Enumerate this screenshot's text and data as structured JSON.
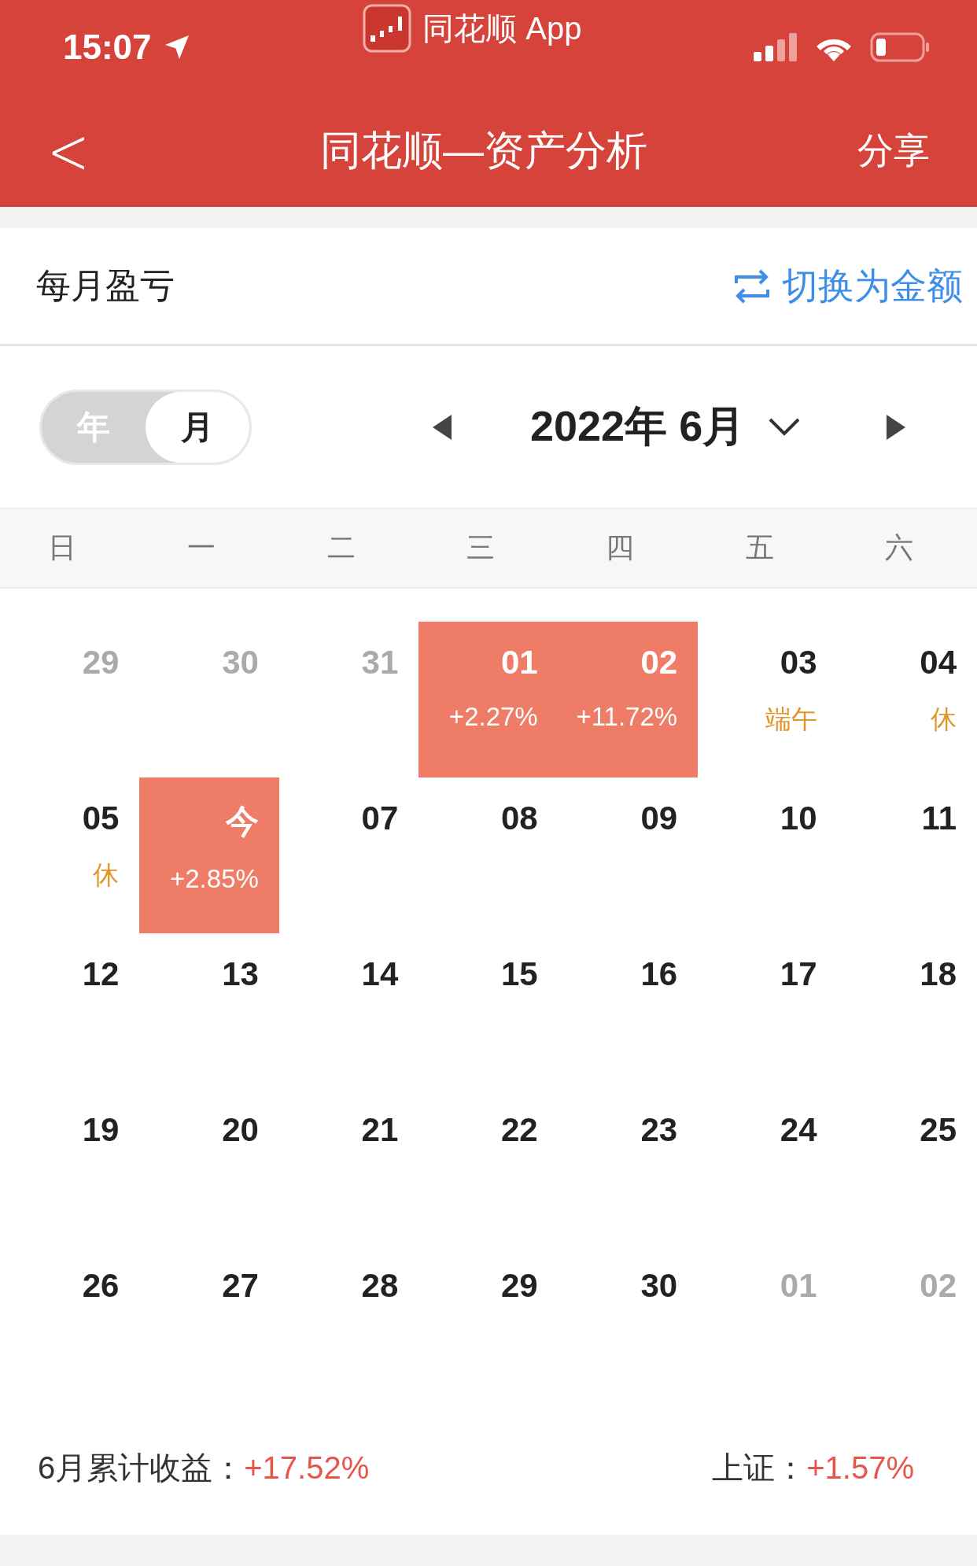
{
  "status_bar": {
    "time": "15:07",
    "app_badge": "同花顺 App"
  },
  "nav": {
    "back": "<",
    "title": "同花顺—资产分析",
    "share": "分享"
  },
  "section": {
    "title": "每月盈亏",
    "switch_link": "切换为金额"
  },
  "mode_tabs": [
    {
      "label": "年",
      "selected": false
    },
    {
      "label": "月",
      "selected": true
    }
  ],
  "month_picker": {
    "label": "2022年 6月"
  },
  "weekdays": [
    "日",
    "一",
    "二",
    "三",
    "四",
    "五",
    "六"
  ],
  "days": [
    {
      "day": "29",
      "kind": "other"
    },
    {
      "day": "30",
      "kind": "other"
    },
    {
      "day": "31",
      "kind": "other"
    },
    {
      "day": "01",
      "kind": "gain",
      "note": "+2.27%"
    },
    {
      "day": "02",
      "kind": "gain",
      "note": "+11.72%"
    },
    {
      "day": "03",
      "kind": "holiday",
      "note": "端午"
    },
    {
      "day": "04",
      "kind": "holiday",
      "note": "休"
    },
    {
      "day": "05",
      "kind": "holiday",
      "note": "休"
    },
    {
      "day": "今",
      "kind": "gain",
      "note": "+2.85%"
    },
    {
      "day": "07",
      "kind": "normal"
    },
    {
      "day": "08",
      "kind": "normal"
    },
    {
      "day": "09",
      "kind": "normal"
    },
    {
      "day": "10",
      "kind": "normal"
    },
    {
      "day": "11",
      "kind": "normal"
    },
    {
      "day": "12",
      "kind": "normal"
    },
    {
      "day": "13",
      "kind": "normal"
    },
    {
      "day": "14",
      "kind": "normal"
    },
    {
      "day": "15",
      "kind": "normal"
    },
    {
      "day": "16",
      "kind": "normal"
    },
    {
      "day": "17",
      "kind": "normal"
    },
    {
      "day": "18",
      "kind": "normal"
    },
    {
      "day": "19",
      "kind": "normal"
    },
    {
      "day": "20",
      "kind": "normal"
    },
    {
      "day": "21",
      "kind": "normal"
    },
    {
      "day": "22",
      "kind": "normal"
    },
    {
      "day": "23",
      "kind": "normal"
    },
    {
      "day": "24",
      "kind": "normal"
    },
    {
      "day": "25",
      "kind": "normal"
    },
    {
      "day": "26",
      "kind": "normal"
    },
    {
      "day": "27",
      "kind": "normal"
    },
    {
      "day": "28",
      "kind": "normal"
    },
    {
      "day": "29",
      "kind": "normal"
    },
    {
      "day": "30",
      "kind": "normal"
    },
    {
      "day": "01",
      "kind": "other"
    },
    {
      "day": "02",
      "kind": "other"
    }
  ],
  "summary": {
    "month_label": "6月累计收益：",
    "month_value": "+17.52%",
    "index_label": "上证：",
    "index_value": "+1.57%"
  }
}
